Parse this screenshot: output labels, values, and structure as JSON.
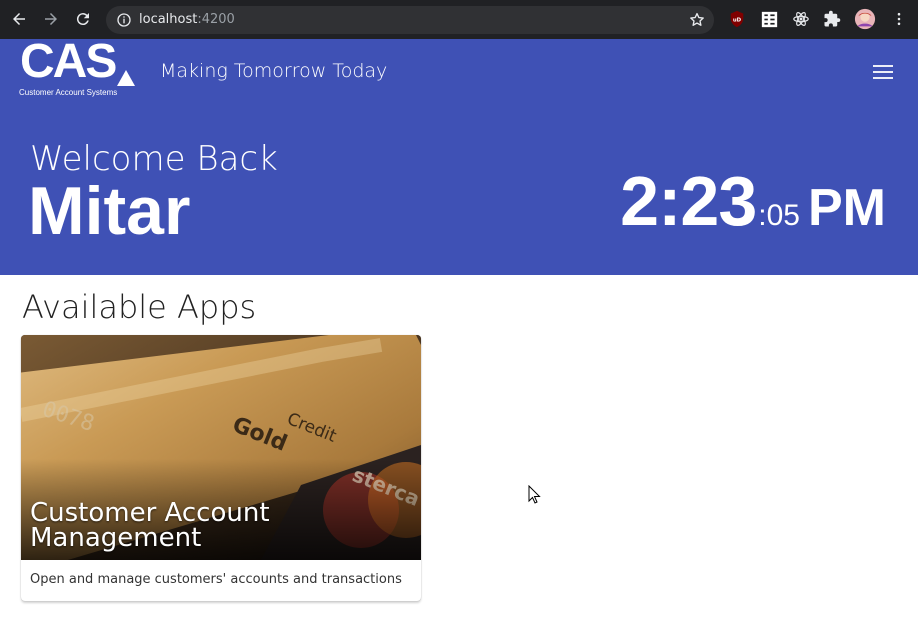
{
  "browser": {
    "url_host": "localhost",
    "url_port": ":4200",
    "icons": [
      "back-arrow-icon",
      "forward-arrow-icon",
      "reload-icon",
      "info-icon",
      "bookmark-star-icon",
      "ublock-extension-icon",
      "reader-extension-icon",
      "react-devtools-icon",
      "extensions-puzzle-icon",
      "profile-avatar",
      "more-vert-icon"
    ]
  },
  "header": {
    "logo_text": "CAS",
    "logo_subtitle": "Customer Account Systems",
    "tagline": "Making Tomorrow Today",
    "welcome": "Welcome Back",
    "user_name": "Mitar",
    "clock": {
      "hours_minutes": "2:23",
      "seconds": ":05",
      "ampm": "PM"
    },
    "background_color": "#3f51b5"
  },
  "main": {
    "section_title": "Available Apps",
    "apps": [
      {
        "title": "Customer Account Management",
        "description": "Open and manage customers' accounts and transactions"
      }
    ]
  }
}
